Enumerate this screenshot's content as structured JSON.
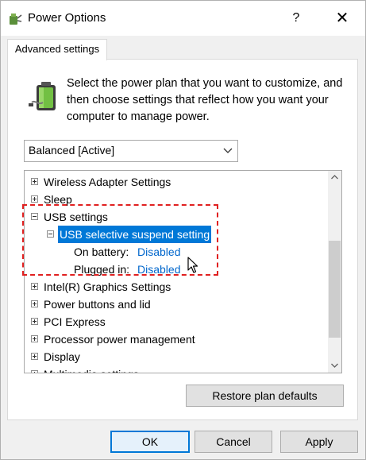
{
  "window": {
    "title": "Power Options",
    "help_label": "?",
    "close_label": "✕"
  },
  "tab": {
    "label": "Advanced settings"
  },
  "description": "Select the power plan that you want to customize, and then choose settings that reflect how you want your computer to manage power.",
  "plan_select": {
    "value": "Balanced [Active]"
  },
  "tree": {
    "items": [
      {
        "label": "Wireless Adapter Settings",
        "expanded": false
      },
      {
        "label": "Sleep",
        "expanded": false
      },
      {
        "label": "USB settings",
        "expanded": true
      },
      {
        "label": "USB selective suspend setting",
        "expanded": true,
        "selected": true
      },
      {
        "label": "On battery:",
        "value": "Disabled"
      },
      {
        "label": "Plugged in:",
        "value": "Disabled"
      },
      {
        "label": "Intel(R) Graphics Settings",
        "expanded": false
      },
      {
        "label": "Power buttons and lid",
        "expanded": false
      },
      {
        "label": "PCI Express",
        "expanded": false
      },
      {
        "label": "Processor power management",
        "expanded": false
      },
      {
        "label": "Display",
        "expanded": false
      },
      {
        "label": "Multimedia settings",
        "expanded": false
      }
    ]
  },
  "buttons": {
    "restore": "Restore plan defaults",
    "ok": "OK",
    "cancel": "Cancel",
    "apply": "Apply"
  },
  "colors": {
    "selection": "#0078d7",
    "link": "#0066cc",
    "highlight_box": "#e02020"
  }
}
